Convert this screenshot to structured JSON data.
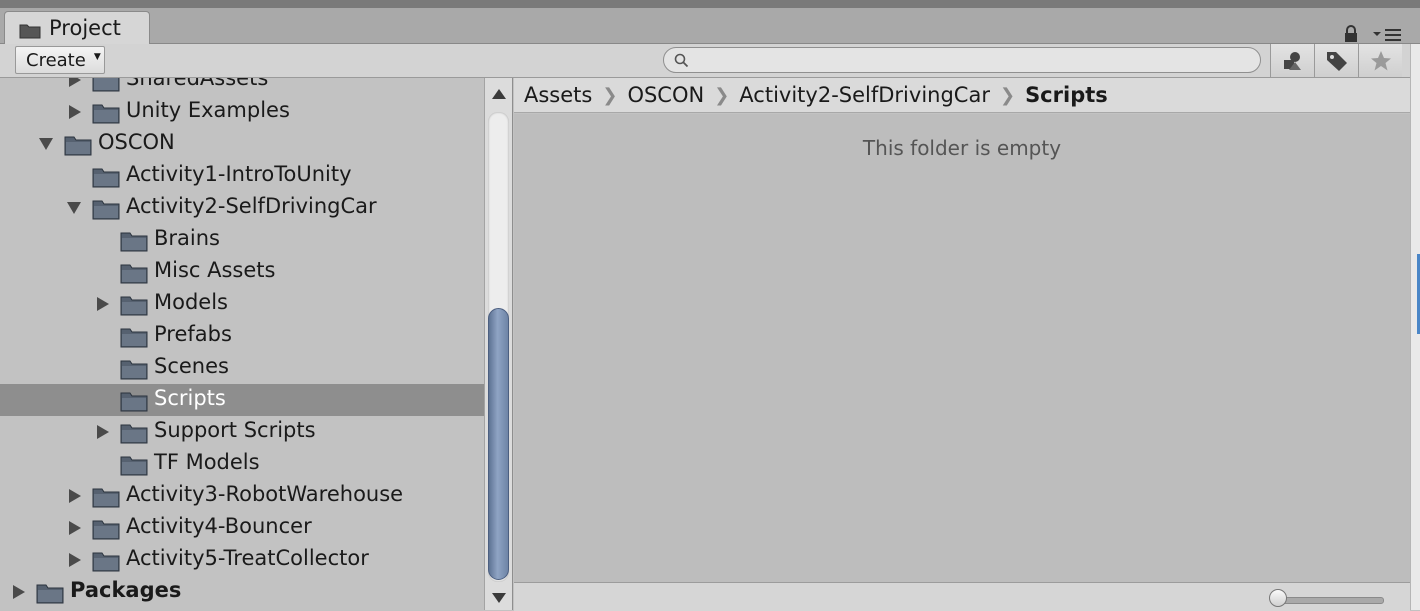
{
  "window": {
    "tab_label": "Project"
  },
  "toolbar": {
    "create_label": "Create",
    "search_value": "",
    "search_placeholder": ""
  },
  "tree": {
    "items": [
      {
        "label": "SharedAssets",
        "expanded": false,
        "has_children": true
      },
      {
        "label": "Unity Examples",
        "expanded": false,
        "has_children": true
      },
      {
        "label": "OSCON",
        "expanded": true,
        "has_children": true
      },
      {
        "label": "Activity1-IntroToUnity",
        "expanded": false,
        "has_children": false
      },
      {
        "label": "Activity2-SelfDrivingCar",
        "expanded": true,
        "has_children": true
      },
      {
        "label": "Brains",
        "expanded": false,
        "has_children": false
      },
      {
        "label": "Misc Assets",
        "expanded": false,
        "has_children": false
      },
      {
        "label": "Models",
        "expanded": false,
        "has_children": true
      },
      {
        "label": "Prefabs",
        "expanded": false,
        "has_children": false
      },
      {
        "label": "Scenes",
        "expanded": false,
        "has_children": false
      },
      {
        "label": "Scripts",
        "expanded": false,
        "has_children": false,
        "selected": true
      },
      {
        "label": "Support Scripts",
        "expanded": false,
        "has_children": true
      },
      {
        "label": "TF Models",
        "expanded": false,
        "has_children": false
      },
      {
        "label": "Activity3-RobotWarehouse",
        "expanded": false,
        "has_children": true
      },
      {
        "label": "Activity4-Bouncer",
        "expanded": false,
        "has_children": true
      },
      {
        "label": "Activity5-TreatCollector",
        "expanded": false,
        "has_children": true
      },
      {
        "label": "Packages",
        "expanded": false,
        "has_children": true
      }
    ]
  },
  "breadcrumb": {
    "items": [
      "Assets",
      "OSCON",
      "Activity2-SelfDrivingCar",
      "Scripts"
    ]
  },
  "content": {
    "empty_message": "This folder is empty"
  },
  "zoom": {
    "value": 0.0
  },
  "colors": {
    "selection": "#8e8e8e",
    "scroll_thumb": "#7489ab",
    "panel_bg": "#c2c2c2"
  },
  "icons": [
    "folder-icon",
    "lock-icon",
    "menu-icon",
    "search-icon",
    "filter-by-type-icon",
    "filter-by-label-icon",
    "favorites-star-icon",
    "scroll-up-icon",
    "scroll-down-icon",
    "expand-arrow-icon",
    "collapse-arrow-icon"
  ]
}
